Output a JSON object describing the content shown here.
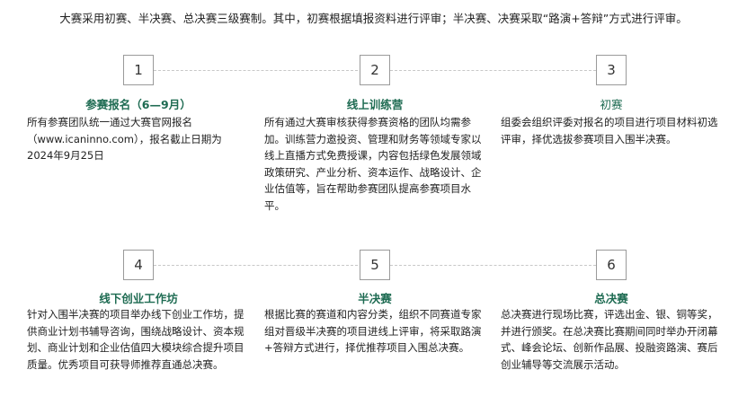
{
  "intro": "大赛采用初赛、半决赛、总决赛三级赛制。其中，初赛根据填报资料进行评审；半决赛、决赛采取“路演+答辩”方式进行评审。",
  "steps": [
    {
      "number": "1",
      "title": "参赛报名（6—9月）",
      "desc_lines": [
        "所有参赛团队统一通过大赛官网报名",
        "（www.icaninno.com），报名截止日期为",
        "2024年9月25日"
      ]
    },
    {
      "number": "2",
      "title": "线上训练营",
      "desc_lines": [
        "所有通过大赛审核获得参赛资格的团队均需参",
        "加。训练营力邀投资、管理和财务等领域专家以",
        "线上直播方式免费授课，内容包括绿色发展领域",
        "政策研究、产业分析、资本运作、战略设计、企",
        "业估值等，旨在帮助参赛团队提高参赛项目水",
        "平。"
      ]
    },
    {
      "number": "3",
      "title": "初赛",
      "desc_lines": [
        "组委会组织评委对报名的项目进行项目材料初选",
        "评审，择优选拔参赛项目入围半决赛。"
      ]
    },
    {
      "number": "4",
      "title": "线下创业工作坊",
      "desc_lines": [
        "针对入围半决赛的项目举办线下创业工作坊，提",
        "供商业计划书辅导咨询，围绕战略设计、资本规",
        "划、商业计划和企业估值四大模块综合提升项目",
        "质量。优秀项目可获导师推荐直通总决赛。"
      ]
    },
    {
      "number": "5",
      "title": "半决赛",
      "desc_lines": [
        "根据比赛的赛道和内容分类，组织不同赛道专家",
        "组对晋级半决赛的项目进线上评审，将采取路演",
        "+答辩方式进行，择优推荐项目入围总决赛。"
      ]
    },
    {
      "number": "6",
      "title": "总决赛",
      "desc_lines": [
        "总决赛进行现场比赛，评选出金、银、铜等奖，",
        "并进行颁奖。在总决赛比赛期间同时举办开闭幕",
        "式、峰会论坛、创新作品展、投融资路演、赛后",
        "创业辅导等交流展示活动。"
      ]
    }
  ]
}
